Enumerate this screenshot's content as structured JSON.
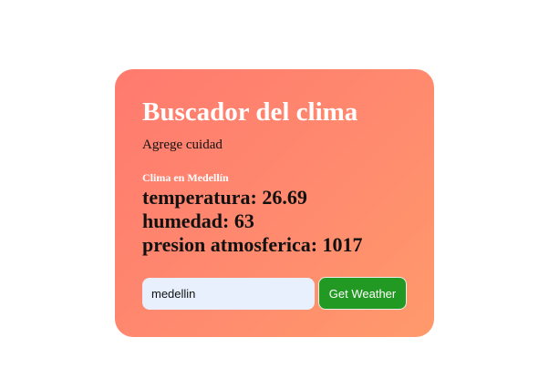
{
  "app": {
    "title": "Buscador del clima",
    "subtitle": "Agrege cuidad"
  },
  "weather": {
    "city_label": "Clima en Medellín",
    "temperature": "temperatura: 26.69",
    "humidity": "humedad: 63",
    "pressure": "presion atmosferica: 1017"
  },
  "form": {
    "search_value": "medellin",
    "button_label": "Get Weather"
  },
  "colors": {
    "card_gradient_start": "#ff7a6e",
    "card_gradient_end": "#ff9a6c",
    "input_background": "#e8f0fe",
    "button_background": "#229922",
    "title_text": "#ffffff"
  }
}
